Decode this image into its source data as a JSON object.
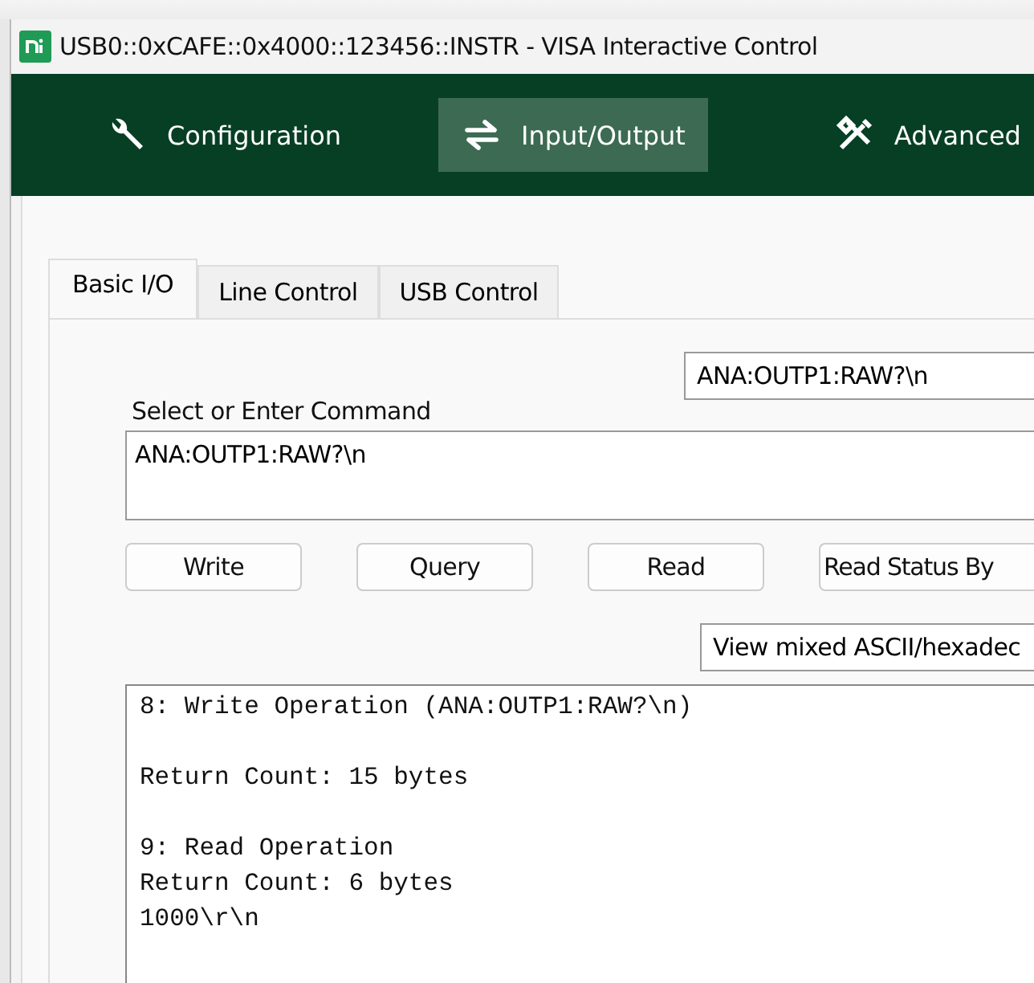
{
  "window": {
    "title": "USB0::0xCAFE::0x4000::123456::INSTR - VISA Interactive Control"
  },
  "nav": [
    {
      "label": "Configuration",
      "kind": "wrench",
      "selected": false
    },
    {
      "label": "Input/Output",
      "kind": "arrows",
      "selected": true
    },
    {
      "label": "Advanced",
      "kind": "tools",
      "selected": false
    }
  ],
  "tabs": [
    {
      "label": "Basic I/O",
      "selected": true
    },
    {
      "label": "Line Control",
      "selected": false
    },
    {
      "label": "USB Control",
      "selected": false
    }
  ],
  "command_history": {
    "value": "ANA:OUTP1:RAW?\\n"
  },
  "command": {
    "label": "Select or Enter Command",
    "value": "ANA:OUTP1:RAW?\\n"
  },
  "buttons": [
    "Write",
    "Query",
    "Read",
    "Read Status By"
  ],
  "view_mode": {
    "value": "View mixed ASCII/hexadec"
  },
  "output": [
    [
      "8: Write Operation (ANA:OUTP1:RAW?\\n)"
    ],
    [
      "Return Count: 15 bytes"
    ],
    [
      "9: Read Operation",
      "Return Count: 6 bytes",
      "1000\\r\\n"
    ]
  ]
}
